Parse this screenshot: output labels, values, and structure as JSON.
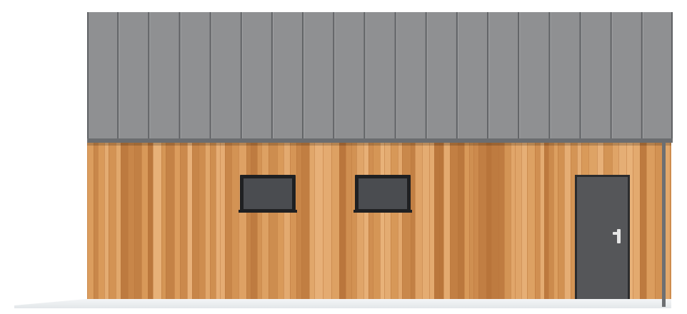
{
  "scene": {
    "subject": "house-elevation",
    "colors": {
      "background": "#ffffff",
      "roof": "#8f9092",
      "roof_seam": "#5f6164",
      "roof_edge": "#6b6d70",
      "wood_base": "#d99a5a",
      "wood_light": "#e8b27a",
      "wood_dark": "#b8743a",
      "window_frame": "#1f2022",
      "window_glass": "#4a4c50",
      "door": "#555659",
      "door_frame": "#2b2c2e",
      "handle": "#e6e6e6",
      "ground": "#eef1f3",
      "downpipe": "#6d6f72"
    },
    "icons": {
      "window": "window-icon",
      "door": "door-icon",
      "handle": "door-handle-icon"
    }
  }
}
